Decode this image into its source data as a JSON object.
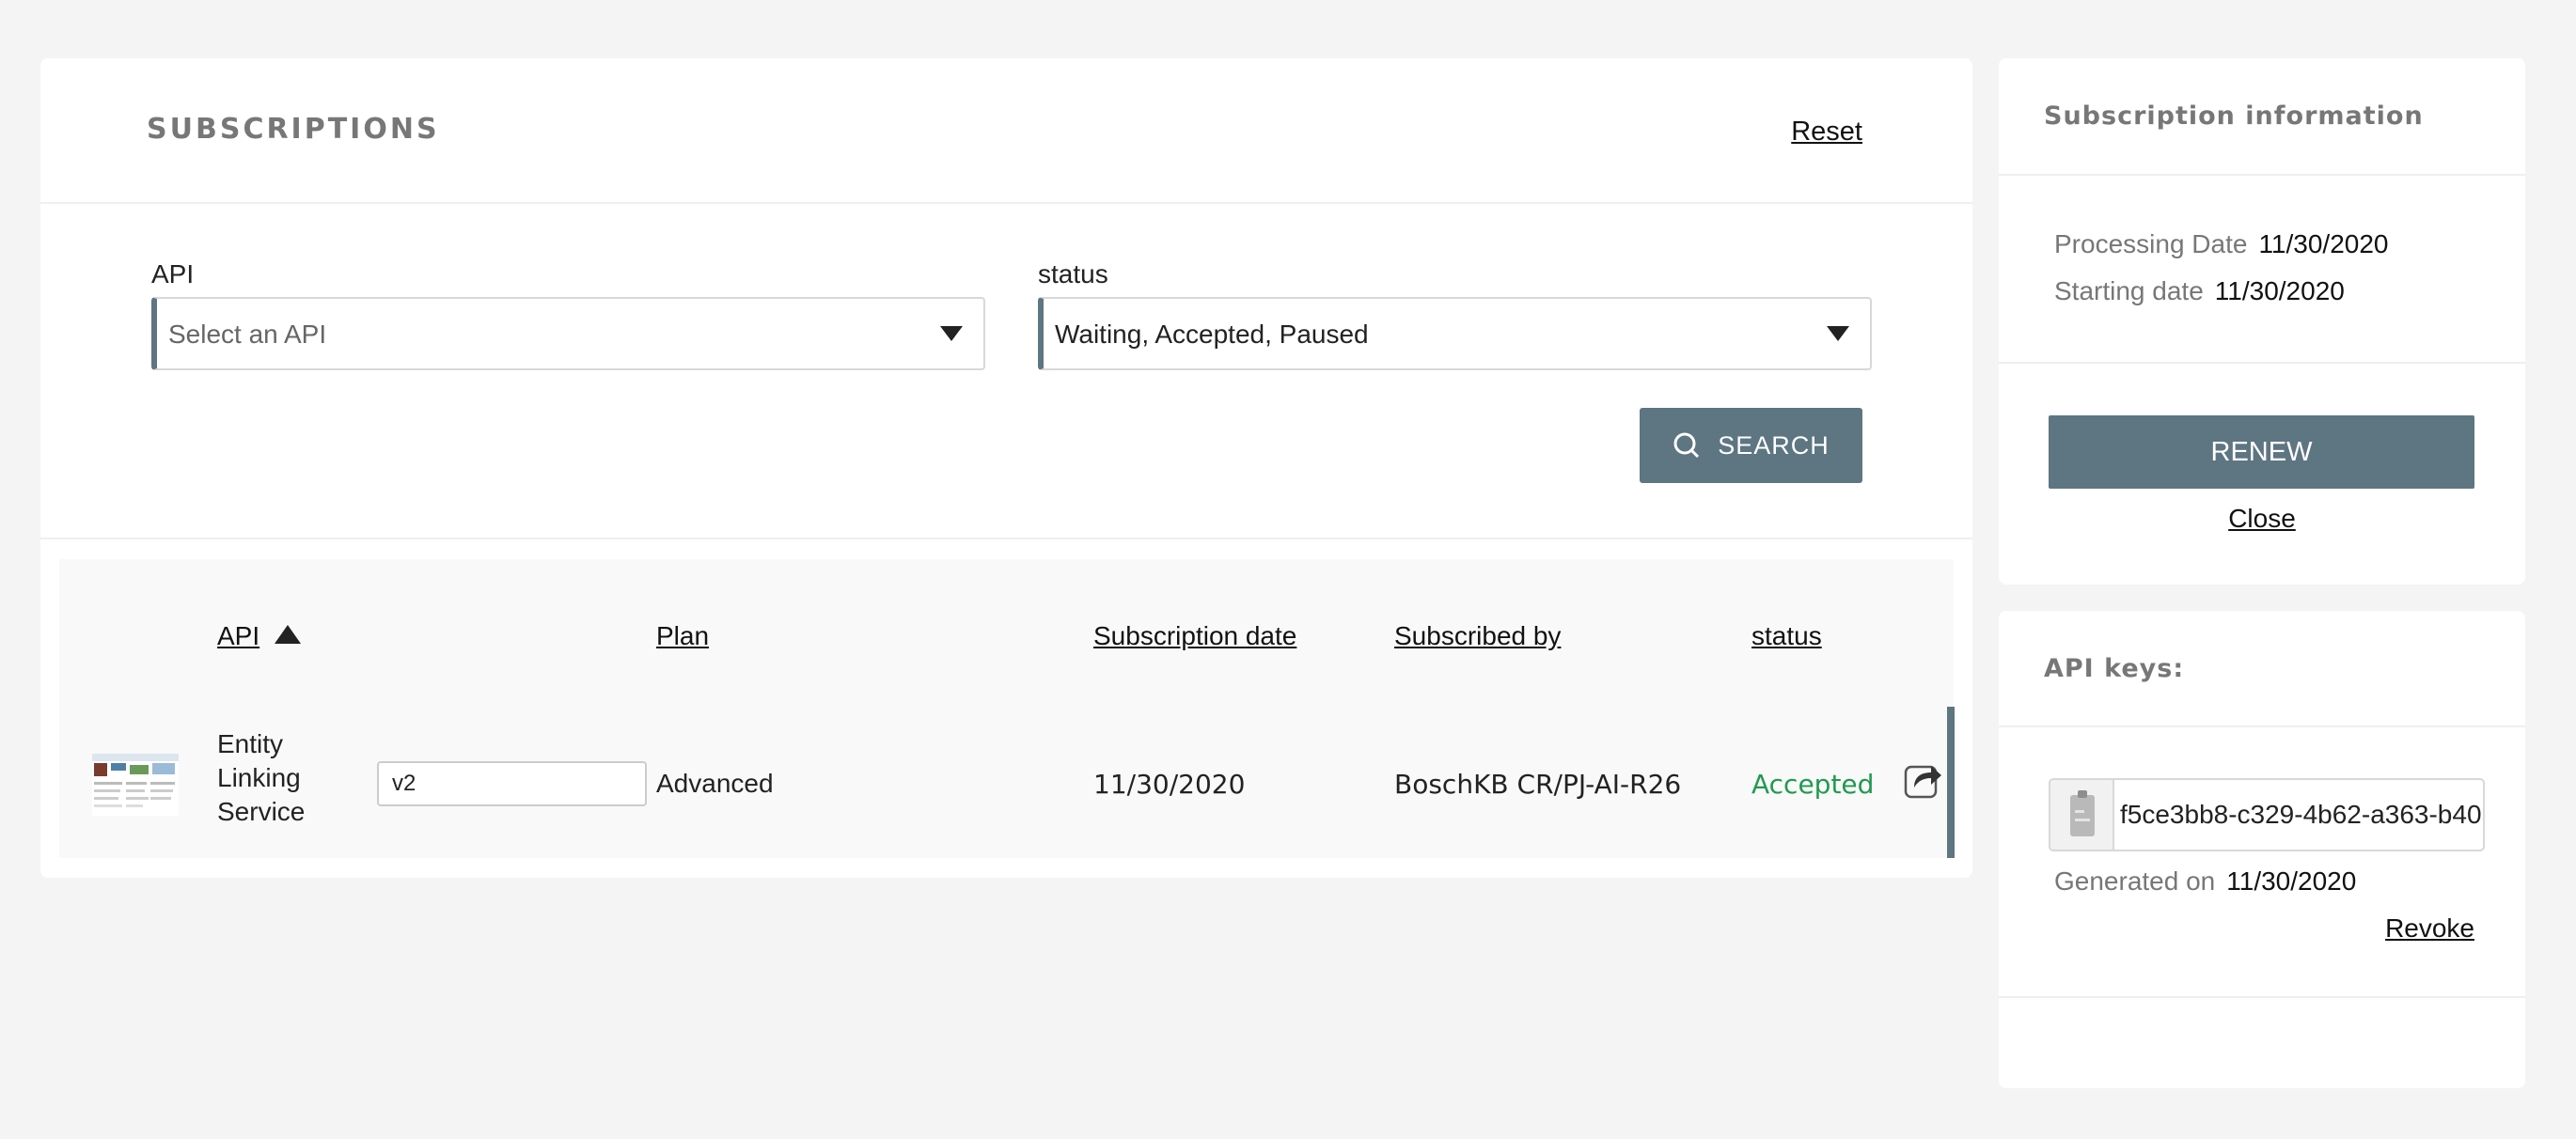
{
  "subscriptions": {
    "title": "SUBSCRIPTIONS",
    "reset_label": "Reset",
    "filters": {
      "api_label": "API",
      "api_placeholder": "Select an API",
      "status_label": "status",
      "status_value": "Waiting, Accepted, Paused",
      "search_label": "SEARCH"
    },
    "table": {
      "columns": {
        "api": "API",
        "plan": "Plan",
        "subscription_date": "Subscription date",
        "subscribed_by": "Subscribed by",
        "status": "status"
      },
      "sort": {
        "column": "API",
        "direction": "ascending"
      },
      "rows": [
        {
          "api_name": "Entity Linking Service",
          "version": "v2",
          "plan": "Advanced",
          "subscription_date": "11/30/2020",
          "subscribed_by": "BoschKB CR/PJ-AI-R26",
          "status": "Accepted"
        }
      ]
    }
  },
  "subscription_info": {
    "title": "Subscription information",
    "processing_date_label": "Processing Date",
    "processing_date": "11/30/2020",
    "starting_date_label": "Starting date",
    "starting_date": "11/30/2020",
    "renew_label": "RENEW",
    "close_label": "Close"
  },
  "api_keys": {
    "title": "API keys:",
    "key_value": "f5ce3bb8-c329-4b62-a363-b40",
    "generated_on_label": "Generated on",
    "generated_on": "11/30/2020",
    "revoke_label": "Revoke"
  },
  "colors": {
    "accent": "#5e7582",
    "accepted": "#1f9a4e",
    "background": "#f4f4f4"
  },
  "icons": [
    "chevron-down-icon",
    "search-icon",
    "sort-ascending-icon",
    "share-icon",
    "clipboard-icon"
  ]
}
